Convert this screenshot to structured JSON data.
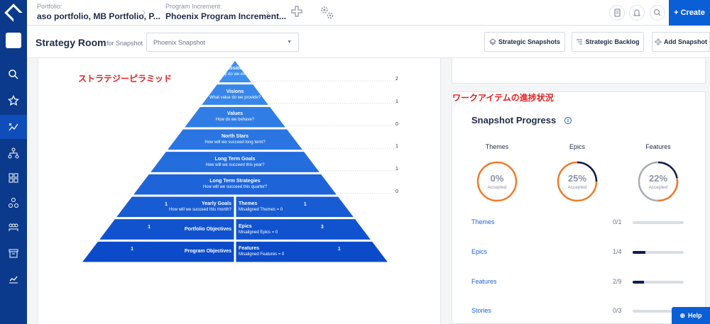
{
  "topbar": {
    "portfolio_label": "Portfolio:",
    "portfolio_value": "aso portfolio, MB Portfolio, P...",
    "pi_label": "Program Increment:",
    "pi_value": "Phoenix Program Increment...",
    "create_label": "Create"
  },
  "header": {
    "title": "Strategy Room",
    "for_snapshot_label": "for Snapshot",
    "snapshot_value": "Phoenix Snapshot",
    "btn_strategic_snapshots": "Strategic Snapshots",
    "btn_strategic_backlog": "Strategic Backlog",
    "btn_add_snapshot": "Add Snapshot"
  },
  "annotations": {
    "pyramid_jp": "ストラテジーピラミッド",
    "work_items_jp": "ワークアイテムの進捗状況"
  },
  "pyramid": {
    "levels": [
      {
        "title": "Missions",
        "sub": "Why do we exist?",
        "count": "2"
      },
      {
        "title": "Visions",
        "sub": "What value do we provide?",
        "count": "1"
      },
      {
        "title": "Values",
        "sub": "How do we behave?",
        "count": "0"
      },
      {
        "title": "North Stars",
        "sub": "How will we succeed long term?",
        "count": "1"
      },
      {
        "title": "Long Term Goals",
        "sub": "How will we succeed this year?",
        "count": "1"
      },
      {
        "title": "Long Term Strategies",
        "sub": "How will we succeed this quarter?",
        "count": "0"
      }
    ],
    "split_rows": [
      {
        "left_count": "1",
        "left_title": "Yearly Goals",
        "left_sub": "How will we succeed this month?",
        "right_title": "Themes",
        "right_sub": "Misaligned Themes = 0",
        "right_count": "1"
      },
      {
        "left_count": "1",
        "left_title": "Portfolio Objectives",
        "left_sub": "",
        "right_title": "Epics",
        "right_sub": "Misaligned Epics = 0",
        "right_count": "3"
      },
      {
        "left_count": "1",
        "left_title": "Program Objectives",
        "left_sub": "",
        "right_title": "Features",
        "right_sub": "Misaligned Features = 0",
        "right_count": "1"
      }
    ]
  },
  "snapshot_progress": {
    "title": "Snapshot Progress",
    "info_icon": "i",
    "gauges": [
      {
        "label": "Themes",
        "percent": "0%",
        "value": 0,
        "accepted": "Accepted"
      },
      {
        "label": "Epics",
        "percent": "25%",
        "value": 0.25,
        "accepted": "Accepted"
      },
      {
        "label": "Features",
        "percent": "22%",
        "value": 0.22,
        "accepted": "Accepted"
      }
    ],
    "rows": [
      {
        "label": "Themes",
        "count": "0/1",
        "fraction": 0
      },
      {
        "label": "Epics",
        "count": "1/4",
        "fraction": 0.25
      },
      {
        "label": "Features",
        "count": "2/9",
        "fraction": 0.22
      },
      {
        "label": "Stories",
        "count": "0/3",
        "fraction": 0
      }
    ]
  },
  "help_label": "Help",
  "colors": {
    "sidebar": "#0b3a8c",
    "accent": "#0b5fd6",
    "pyramid_top": "#3d8ef0",
    "pyramid_bottom": "#0b4bc9",
    "gauge_orange": "#f07c2a",
    "gauge_navy": "#0e1f52",
    "annotation_red": "#e41e1e"
  }
}
